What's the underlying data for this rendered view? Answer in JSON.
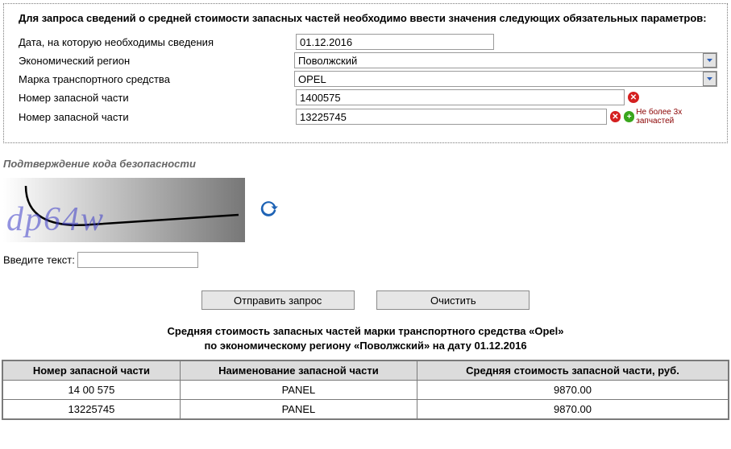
{
  "form": {
    "title": "Для запроса сведений о средней стоимости запасных частей необходимо ввести значения следующих обязательных параметров:",
    "labels": {
      "date": "Дата, на которую необходимы сведения",
      "region": "Экономический регион",
      "brand": "Марка транспортного средства",
      "part": "Номер запасной части"
    },
    "values": {
      "date": "01.12.2016",
      "region": "Поволжский",
      "brand": "OPEL",
      "parts": [
        "1400575",
        "13225745"
      ]
    },
    "no_more_parts": "Не более 3х запчастей"
  },
  "captcha": {
    "heading": "Подтверждение кода безопасности",
    "text": "dp64w",
    "input_label": "Введите текст:"
  },
  "buttons": {
    "submit": "Отправить запрос",
    "clear": "Очистить"
  },
  "results": {
    "heading_line1": "Средняя стоимость запасных частей марки транспортного средства «Opel»",
    "heading_line2": "по экономическому региону «Поволжский» на дату 01.12.2016",
    "columns": [
      "Номер запасной части",
      "Наименование запасной части",
      "Средняя стоимость запасной части, руб."
    ],
    "rows": [
      {
        "num": "14 00 575",
        "name": "PANEL",
        "cost": "9870.00"
      },
      {
        "num": "13225745",
        "name": "PANEL",
        "cost": "9870.00"
      }
    ]
  }
}
